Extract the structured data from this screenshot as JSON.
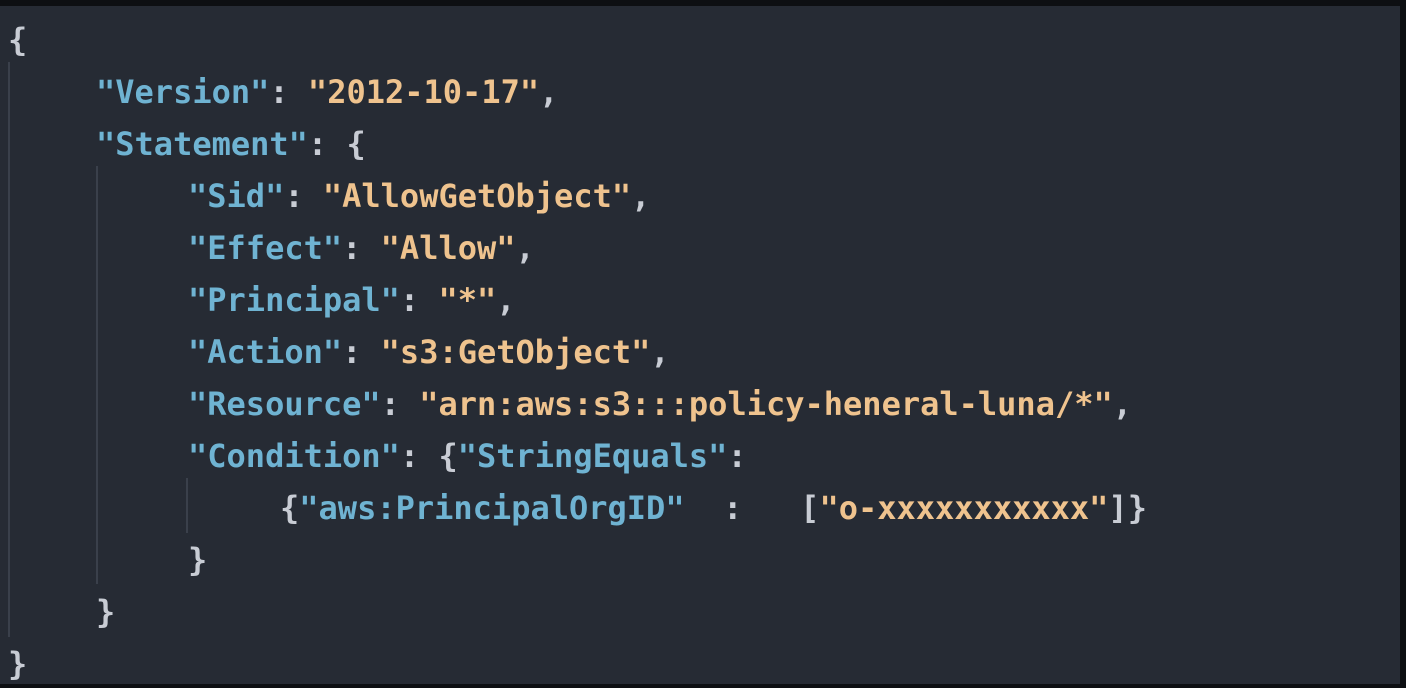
{
  "colors": {
    "background": "#262b34",
    "key": "#6fb3d2",
    "string": "#efc38e",
    "punctuation": "#c8ccd4",
    "indent_guide": "#3a404b"
  },
  "lines": [
    {
      "tokens": [
        {
          "t": "{",
          "k": "brc"
        }
      ]
    },
    {
      "tokens": [
        {
          "t": "\"Version\"",
          "k": "key"
        },
        {
          "t": ": ",
          "k": "pun"
        },
        {
          "t": "\"2012-10-17\"",
          "k": "str"
        },
        {
          "t": ",",
          "k": "pun"
        }
      ]
    },
    {
      "tokens": [
        {
          "t": "\"Statement\"",
          "k": "key"
        },
        {
          "t": ": ",
          "k": "pun"
        },
        {
          "t": "{",
          "k": "brc"
        }
      ]
    },
    {
      "tokens": [
        {
          "t": "\"Sid\"",
          "k": "key"
        },
        {
          "t": ": ",
          "k": "pun"
        },
        {
          "t": "\"AllowGetObject\"",
          "k": "str"
        },
        {
          "t": ",",
          "k": "pun"
        }
      ]
    },
    {
      "tokens": [
        {
          "t": "\"Effect\"",
          "k": "key"
        },
        {
          "t": ": ",
          "k": "pun"
        },
        {
          "t": "\"Allow\"",
          "k": "str"
        },
        {
          "t": ",",
          "k": "pun"
        }
      ]
    },
    {
      "tokens": [
        {
          "t": "\"Principal\"",
          "k": "key"
        },
        {
          "t": ": ",
          "k": "pun"
        },
        {
          "t": "\"*\"",
          "k": "str"
        },
        {
          "t": ",",
          "k": "pun"
        }
      ]
    },
    {
      "tokens": [
        {
          "t": "\"Action\"",
          "k": "key"
        },
        {
          "t": ": ",
          "k": "pun"
        },
        {
          "t": "\"s3:GetObject\"",
          "k": "str"
        },
        {
          "t": ",",
          "k": "pun"
        }
      ]
    },
    {
      "tokens": [
        {
          "t": "\"Resource\"",
          "k": "key"
        },
        {
          "t": ": ",
          "k": "pun"
        },
        {
          "t": "\"arn:aws:s3:::policy-heneral-luna/*\"",
          "k": "str"
        },
        {
          "t": ",",
          "k": "pun"
        }
      ]
    },
    {
      "tokens": [
        {
          "t": "\"Condition\"",
          "k": "key"
        },
        {
          "t": ": ",
          "k": "pun"
        },
        {
          "t": "{",
          "k": "brc"
        },
        {
          "t": "\"StringEquals\"",
          "k": "key"
        },
        {
          "t": ":",
          "k": "pun"
        }
      ]
    },
    {
      "tokens": [
        {
          "t": "{",
          "k": "brc"
        },
        {
          "t": "\"aws:PrincipalOrgID\"",
          "k": "key"
        },
        {
          "t": "  :   ",
          "k": "pun"
        },
        {
          "t": "[",
          "k": "brc"
        },
        {
          "t": "\"o-xxxxxxxxxxx\"",
          "k": "str"
        },
        {
          "t": "]}",
          "k": "brc"
        }
      ]
    },
    {
      "tokens": [
        {
          "t": "}",
          "k": "brc"
        }
      ]
    },
    {
      "tokens": [
        {
          "t": "}",
          "k": "brc"
        }
      ]
    },
    {
      "tokens": [
        {
          "t": "}",
          "k": "brc"
        }
      ]
    }
  ]
}
